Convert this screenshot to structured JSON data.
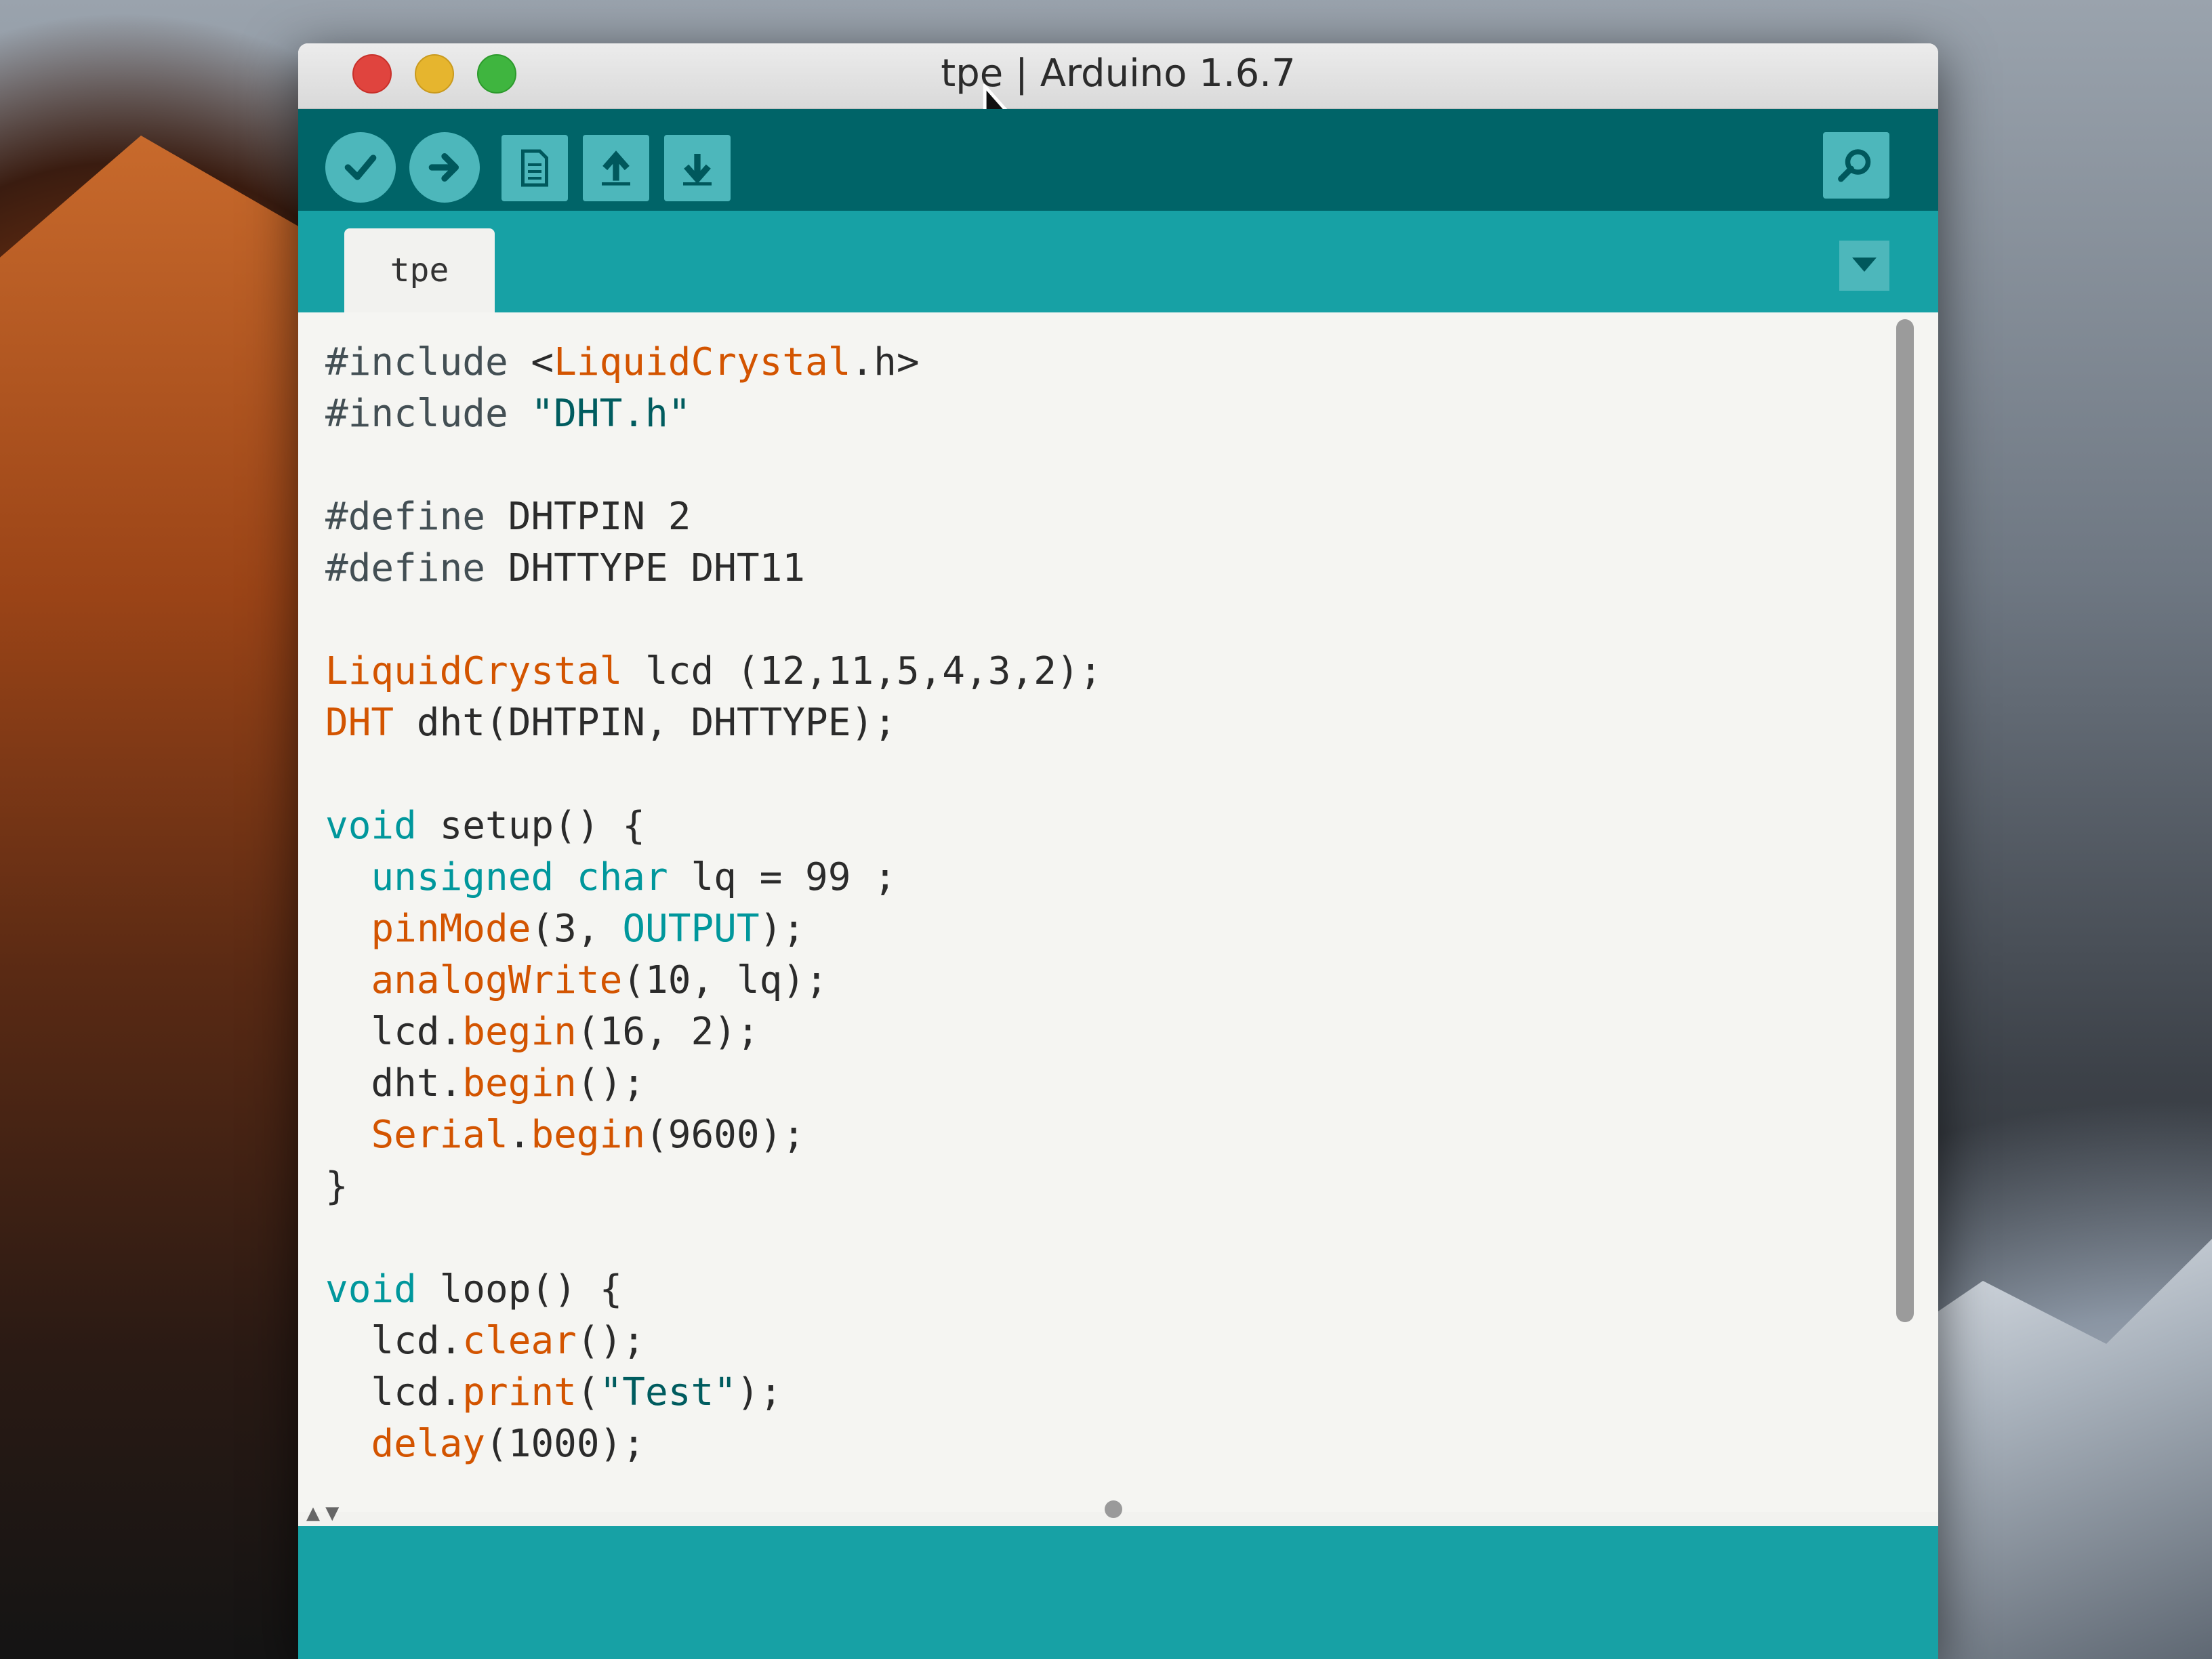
{
  "window": {
    "title": "tpe | Arduino 1.6.7"
  },
  "toolbar": {
    "buttons": [
      {
        "name": "verify",
        "icon": "check-icon"
      },
      {
        "name": "upload",
        "icon": "arrow-right-icon"
      },
      {
        "name": "new",
        "icon": "new-file-icon"
      },
      {
        "name": "open",
        "icon": "arrow-up-icon"
      },
      {
        "name": "save",
        "icon": "arrow-down-icon"
      },
      {
        "name": "serial-monitor",
        "icon": "magnifier-icon"
      }
    ]
  },
  "tabs": [
    {
      "label": "tpe",
      "active": true
    }
  ],
  "editor": {
    "lines": [
      "#include <LiquidCrystal.h>",
      "#include \"DHT.h\"",
      "",
      "#define DHTPIN 2",
      "#define DHTTYPE DHT11",
      "",
      "LiquidCrystal lcd (12,11,5,4,3,2);",
      "DHT dht(DHTPIN, DHTTYPE);",
      "",
      "void setup() {",
      "  unsigned char lq = 99 ;",
      "  pinMode(3, OUTPUT);",
      "  analogWrite(10, lq);",
      "  lcd.begin(16, 2);",
      "  dht.begin();",
      "  Serial.begin(9600);",
      "}",
      "",
      "void loop() {",
      "  lcd.clear();",
      "  lcd.print(\"Test\");",
      "  delay(1000);"
    ]
  },
  "colors": {
    "toolbar_bg": "#006468",
    "tabbar_bg": "#17a1a5",
    "button_bg": "#4db7bb",
    "keyword": "#00979c",
    "function": "#d35400"
  }
}
